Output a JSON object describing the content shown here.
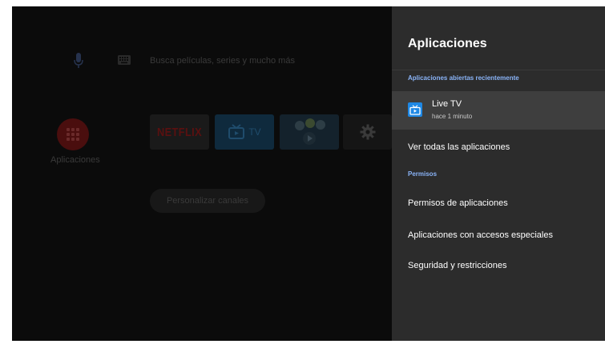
{
  "home": {
    "search_hint": "Busca películas, series y mucho más",
    "apps_label": "Aplicaciones",
    "tiles": {
      "netflix": "NETFLIX",
      "tv": "TV"
    },
    "personalize_label": "Personalizar canales"
  },
  "panel": {
    "title": "Aplicaciones",
    "recent_header": "Aplicaciones abiertas recientemente",
    "recent_app": {
      "name": "Live TV",
      "subtitle": "hace 1 minuto",
      "icon": "live-tv-icon"
    },
    "see_all": "Ver todas las aplicaciones",
    "permissions_header": "Permisos",
    "items": [
      "Permisos de aplicaciones",
      "Aplicaciones con accesos especiales",
      "Seguridad y restricciones"
    ]
  },
  "colors": {
    "accent": "#8ab4f8",
    "panel_bg": "#2c2c2c",
    "selected_bg": "#3e3e3e",
    "app_icon_blue": "#1e88e5"
  }
}
